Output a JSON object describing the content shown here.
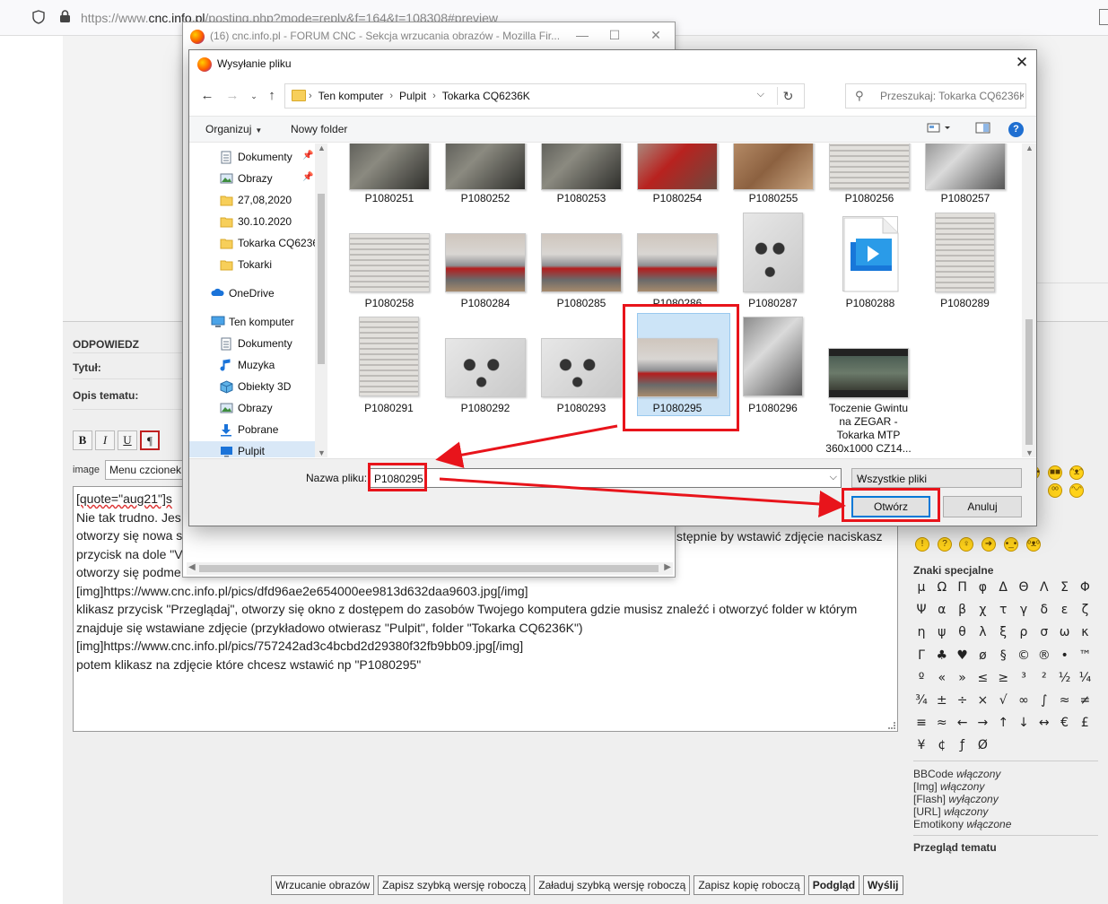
{
  "browser": {
    "url_prefix": "https://www.",
    "url_domain": "cnc.info.pl",
    "url_path": "/posting.php?mode=reply&f=164&t=108308#preview"
  },
  "forum": {
    "reply_heading": "ODPOWIEDZ",
    "title_label": "Tytuł:",
    "desc_label": "Opis tematu:",
    "format_buttons": [
      "B",
      "I",
      "U",
      "¶"
    ],
    "image_label": "image",
    "font_select": "Menu czcionek",
    "message_lines": [
      "[quote=\"aug21\"]s",
      "Nie tak trudno. Jes",
      "otworzy się nowa s",
      "przycisk na dole \"V",
      "otworzy się podme",
      "[img]https://www.cnc.info.pl/pics/dfd96ae2e654000ee9813d632daa9603.jpg[/img]",
      "klikasz przycisk \"Przeglądaj\", otworzy się okno z dostępem do zasobów Twojego komputera gdzie musisz znaleźć i otworzyć folder w którym",
      "znajduje się wstawiane zdjęcie (przykładowo otwierasz \"Pulpit\", folder \"Tokarka CQ6236K\")",
      "[img]https://www.cnc.info.pl/pics/757242ad3c4bcbd2d29380f32fb9bb09.jpg[/img]",
      "potem klikasz na zdjęcie które chcesz wstawić np \"P1080295\""
    ],
    "message_tail": "stępnie by wstawić zdjęcie naciskasz",
    "special_chars_title": "Znaki specjalne",
    "special_chars": [
      "μ",
      "Ω",
      "Π",
      "φ",
      "Δ",
      "Θ",
      "Λ",
      "Σ",
      "Φ",
      "Ψ",
      "α",
      "β",
      "χ",
      "τ",
      "γ",
      "δ",
      "ε",
      "ζ",
      "η",
      "ψ",
      "θ",
      "λ",
      "ξ",
      "ρ",
      "σ",
      "ω",
      "κ",
      "Γ",
      "♣",
      "♥",
      "ø",
      "§",
      "©",
      "®",
      "•",
      "™",
      "º",
      "«",
      "»",
      "≤",
      "≥",
      "³",
      "²",
      "½",
      "¼",
      "¾",
      "±",
      "÷",
      "×",
      "√",
      "∞",
      "∫",
      "≈",
      "≠",
      "≡",
      "≈",
      "←",
      "→",
      "↑",
      "↓",
      "↔",
      "€",
      "£",
      "¥",
      "¢",
      "ƒ",
      "Ø"
    ],
    "status": [
      {
        "name": "BBCode",
        "value": "włączony"
      },
      {
        "name": "[Img]",
        "value": "włączony"
      },
      {
        "name": "[Flash]",
        "value": "wyłączony"
      },
      {
        "name": "[URL]",
        "value": "włączony"
      },
      {
        "name": "Emotikony",
        "value": "włączone"
      }
    ],
    "review_label": "Przegląd tematu",
    "bottom_buttons": [
      {
        "label": "Wrzucanie obrazów",
        "bold": false
      },
      {
        "label": "Zapisz szybką wersję roboczą",
        "bold": false
      },
      {
        "label": "Załaduj szybką wersję roboczą",
        "bold": false
      },
      {
        "label": "Zapisz kopię roboczą",
        "bold": false
      },
      {
        "label": "Podgląd",
        "bold": true
      },
      {
        "label": "Wyślij",
        "bold": true
      }
    ]
  },
  "popup": {
    "title": "(16) cnc.info.pl - FORUM CNC - Sekcja wrzucania obrazów - Mozilla Fir..."
  },
  "dialog": {
    "title": "Wysyłanie pliku",
    "breadcrumbs": [
      "Ten komputer",
      "Pulpit",
      "Tokarka CQ6236K"
    ],
    "search_placeholder": "Przeszukaj: Tokarka CQ6236K",
    "organize_label": "Organizuj",
    "new_folder_label": "Nowy folder",
    "nav_items": [
      {
        "label": "Dokumenty",
        "icon": "documents-icon",
        "indent": 1,
        "pinned": true,
        "selected": false
      },
      {
        "label": "Obrazy",
        "icon": "pictures-icon",
        "indent": 1,
        "pinned": true,
        "selected": false
      },
      {
        "label": "27,08,2020",
        "icon": "folder-icon",
        "indent": 1,
        "pinned": false,
        "selected": false
      },
      {
        "label": "30.10.2020",
        "icon": "folder-icon",
        "indent": 1,
        "pinned": false,
        "selected": false
      },
      {
        "label": "Tokarka CQ6236K",
        "icon": "folder-icon",
        "indent": 1,
        "pinned": false,
        "selected": false
      },
      {
        "label": "Tokarki",
        "icon": "folder-icon",
        "indent": 1,
        "pinned": false,
        "selected": false
      },
      {
        "label": "OneDrive",
        "icon": "onedrive-icon",
        "indent": 0,
        "pinned": false,
        "selected": false
      },
      {
        "label": "Ten komputer",
        "icon": "computer-icon",
        "indent": 0,
        "pinned": false,
        "selected": false
      },
      {
        "label": "Dokumenty",
        "icon": "documents-icon",
        "indent": 1,
        "pinned": false,
        "selected": false
      },
      {
        "label": "Muzyka",
        "icon": "music-icon",
        "indent": 1,
        "pinned": false,
        "selected": false
      },
      {
        "label": "Obiekty 3D",
        "icon": "objects3d-icon",
        "indent": 1,
        "pinned": false,
        "selected": false
      },
      {
        "label": "Obrazy",
        "icon": "pictures-icon",
        "indent": 1,
        "pinned": false,
        "selected": false
      },
      {
        "label": "Pobrane",
        "icon": "downloads-icon",
        "indent": 1,
        "pinned": false,
        "selected": false
      },
      {
        "label": "Pulpit",
        "icon": "desktop-icon",
        "indent": 1,
        "pinned": false,
        "selected": true
      }
    ],
    "files": [
      "P1080251",
      "P1080252",
      "P1080253",
      "P1080254",
      "P1080255",
      "P1080256",
      "P1080257",
      "P1080258",
      "P1080284",
      "P1080285",
      "P1080286",
      "P1080287",
      "P1080288",
      "P1080289",
      "P1080291",
      "P1080292",
      "P1080293",
      "P1080295",
      "P1080296",
      "Toczenie Gwintu na ZEGAR - Tokarka MTP 360x1000 CZ14..."
    ],
    "selected_file": "P1080295",
    "filename_label": "Nazwa pliku:",
    "filename_value": "P1080295",
    "filetype_value": "Wszystkie pliki",
    "open_label": "Otwórz",
    "cancel_label": "Anuluj"
  },
  "colors": {
    "annotation_red": "#e8141b",
    "selection_blue": "#cce4f7",
    "primary_border": "#0078d7"
  }
}
